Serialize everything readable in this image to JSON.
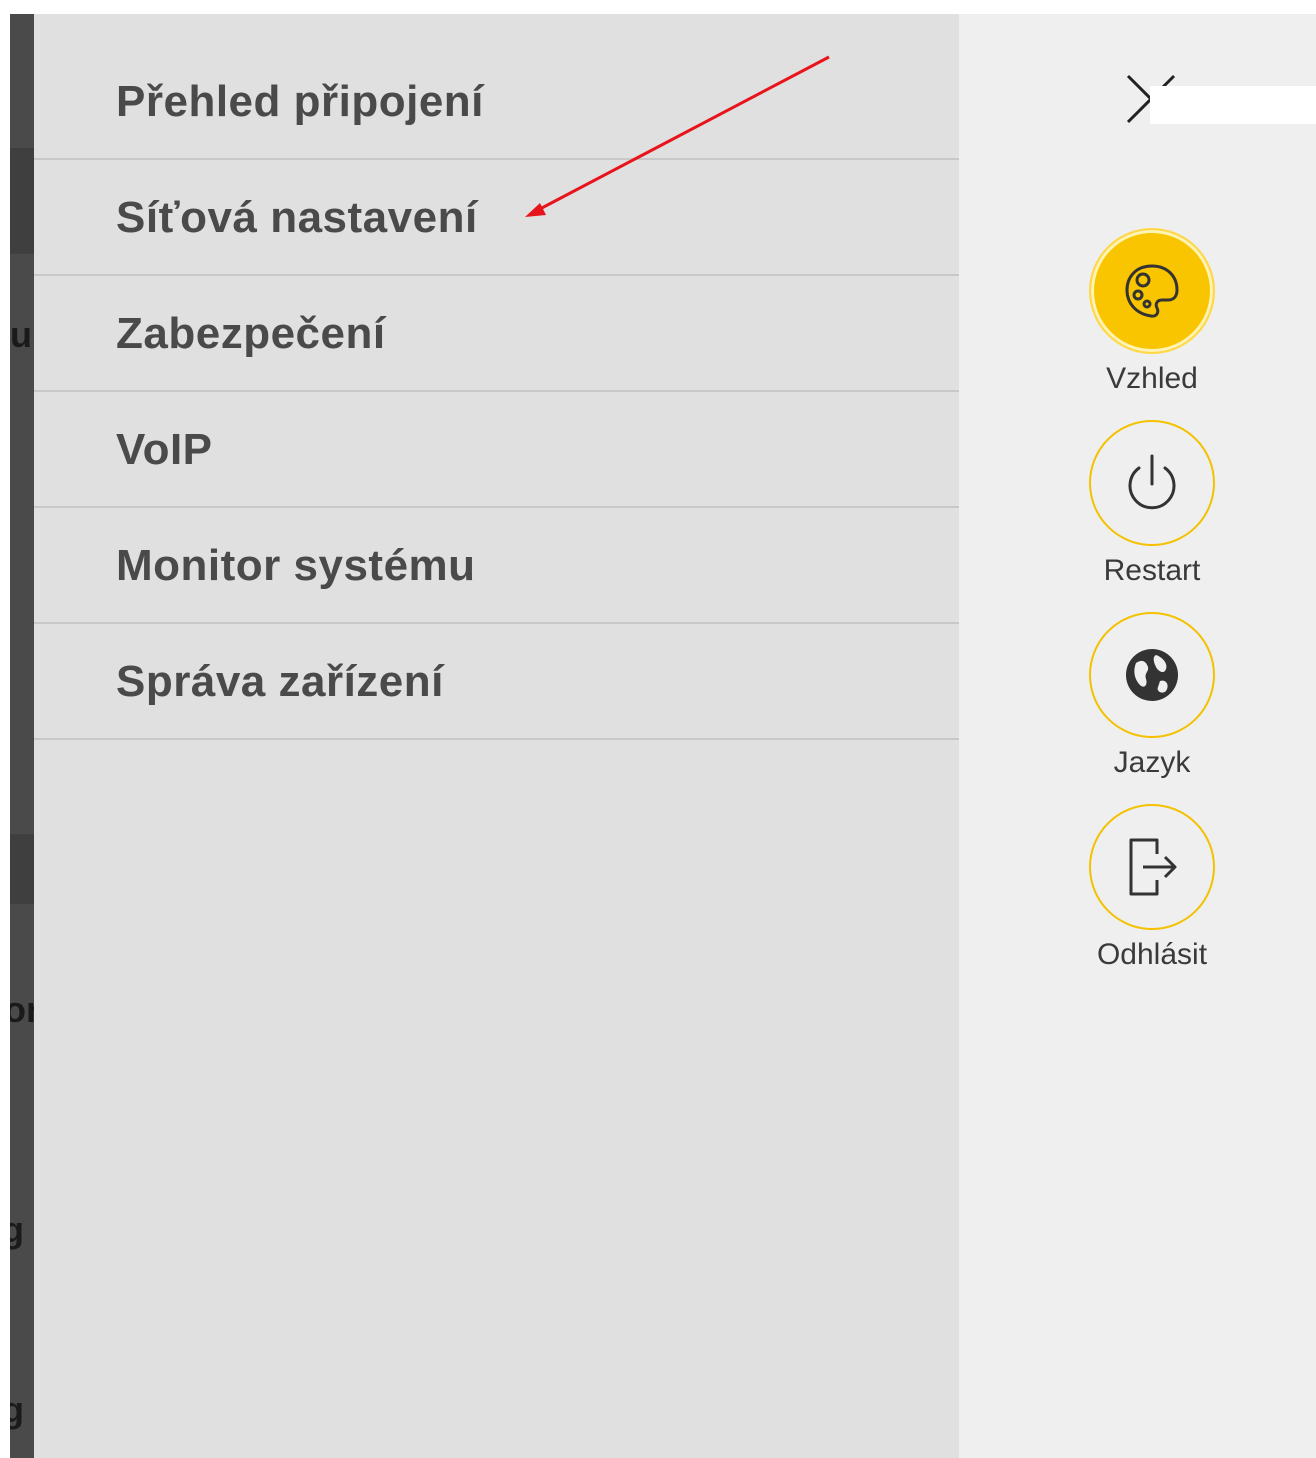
{
  "menu": {
    "items": [
      {
        "label": "Přehled připojení"
      },
      {
        "label": "Síťová nastavení"
      },
      {
        "label": "Zabezpečení"
      },
      {
        "label": "VoIP"
      },
      {
        "label": "Monitor systému"
      },
      {
        "label": "Správa zařízení"
      }
    ]
  },
  "side_panel": {
    "close_icon": "close-icon",
    "actions": [
      {
        "label": "Vzhled",
        "icon": "palette-icon",
        "active": true
      },
      {
        "label": "Restart",
        "icon": "power-icon",
        "active": false
      },
      {
        "label": "Jazyk",
        "icon": "globe-icon",
        "active": false
      },
      {
        "label": "Odhlásit",
        "icon": "logout-icon",
        "active": false
      }
    ]
  },
  "background_fragments": [
    "u",
    "or",
    "g",
    "g"
  ],
  "colors": {
    "menu_bg": "#e0e0e0",
    "side_bg": "#efefef",
    "accent": "#f9c400",
    "text": "#4a4a4a",
    "annotation_arrow": "#e8141c"
  }
}
